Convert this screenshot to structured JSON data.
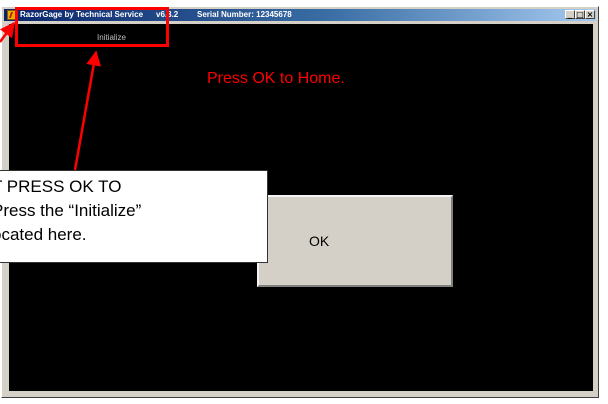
{
  "window": {
    "app_name": "RazorGage  by  Technical Service",
    "version": "v6.3.2",
    "serial": "Serial Number: 12345678",
    "controls": {
      "minimize": "_",
      "maximize": "□",
      "close": "×"
    }
  },
  "client": {
    "initialize_label": "Initialize",
    "message": "Press OK to Home.",
    "ok_label": "OK"
  },
  "annotation": {
    "lines": [
      "T PRESS OK TO",
      "  Press the “Initialize”",
      "ocated here."
    ]
  },
  "colors": {
    "annotation_red": "#ff0000",
    "message_red": "#ff0000",
    "client_background": "#000000"
  }
}
